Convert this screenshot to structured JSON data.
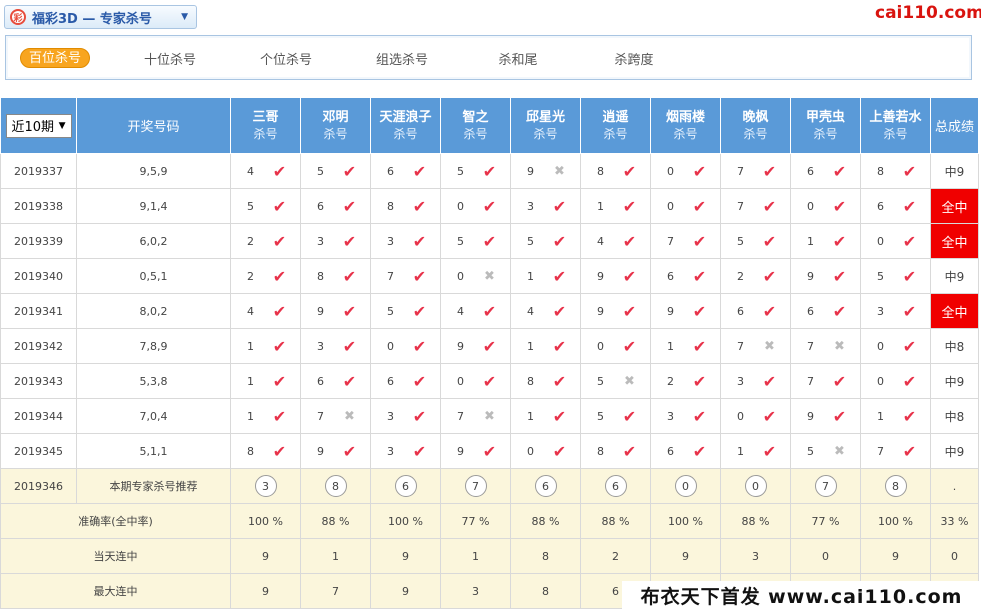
{
  "header": {
    "logo_char": "彩",
    "lottery_title": "福彩3D — 专家杀号",
    "site_logo": "cai110.com"
  },
  "tabs": [
    "百位杀号",
    "十位杀号",
    "个位杀号",
    "组选杀号",
    "杀和尾",
    "杀跨度"
  ],
  "active_tab": 0,
  "table": {
    "period_select": "近10期",
    "draw_col": "开奖号码",
    "total_col": "总成绩",
    "expert_sub": "杀号",
    "experts": [
      "三哥",
      "邓明",
      "天涯浪子",
      "智之",
      "邱星光",
      "逍遥",
      "烟雨楼",
      "晚枫",
      "甲壳虫",
      "上善若水"
    ],
    "rows": [
      {
        "issue": "2019337",
        "draw": "9,5,9",
        "kills": [
          4,
          5,
          6,
          5,
          9,
          8,
          0,
          7,
          6,
          8
        ],
        "hits": [
          1,
          1,
          1,
          1,
          0,
          1,
          1,
          1,
          1,
          1
        ],
        "total": "中9",
        "all": false
      },
      {
        "issue": "2019338",
        "draw": "9,1,4",
        "kills": [
          5,
          6,
          8,
          0,
          3,
          1,
          0,
          7,
          0,
          6
        ],
        "hits": [
          1,
          1,
          1,
          1,
          1,
          1,
          1,
          1,
          1,
          1
        ],
        "total": "全中",
        "all": true
      },
      {
        "issue": "2019339",
        "draw": "6,0,2",
        "kills": [
          2,
          3,
          3,
          5,
          5,
          4,
          7,
          5,
          1,
          0
        ],
        "hits": [
          1,
          1,
          1,
          1,
          1,
          1,
          1,
          1,
          1,
          1
        ],
        "total": "全中",
        "all": true
      },
      {
        "issue": "2019340",
        "draw": "0,5,1",
        "kills": [
          2,
          8,
          7,
          0,
          1,
          9,
          6,
          2,
          9,
          5
        ],
        "hits": [
          1,
          1,
          1,
          0,
          1,
          1,
          1,
          1,
          1,
          1
        ],
        "total": "中9",
        "all": false
      },
      {
        "issue": "2019341",
        "draw": "8,0,2",
        "kills": [
          4,
          9,
          5,
          4,
          4,
          9,
          9,
          6,
          6,
          3
        ],
        "hits": [
          1,
          1,
          1,
          1,
          1,
          1,
          1,
          1,
          1,
          1
        ],
        "total": "全中",
        "all": true
      },
      {
        "issue": "2019342",
        "draw": "7,8,9",
        "kills": [
          1,
          3,
          0,
          9,
          1,
          0,
          1,
          7,
          7,
          0
        ],
        "hits": [
          1,
          1,
          1,
          1,
          1,
          1,
          1,
          0,
          0,
          1
        ],
        "total": "中8",
        "all": false
      },
      {
        "issue": "2019343",
        "draw": "5,3,8",
        "kills": [
          1,
          6,
          6,
          0,
          8,
          5,
          2,
          3,
          7,
          0
        ],
        "hits": [
          1,
          1,
          1,
          1,
          1,
          0,
          1,
          1,
          1,
          1
        ],
        "total": "中9",
        "all": false
      },
      {
        "issue": "2019344",
        "draw": "7,0,4",
        "kills": [
          1,
          7,
          3,
          7,
          1,
          5,
          3,
          0,
          9,
          1
        ],
        "hits": [
          1,
          0,
          1,
          0,
          1,
          1,
          1,
          1,
          1,
          1
        ],
        "total": "中8",
        "all": false
      },
      {
        "issue": "2019345",
        "draw": "5,1,1",
        "kills": [
          8,
          9,
          3,
          9,
          0,
          8,
          6,
          1,
          5,
          7
        ],
        "hits": [
          1,
          1,
          1,
          1,
          1,
          1,
          1,
          1,
          0,
          1
        ],
        "total": "中9",
        "all": false
      }
    ],
    "recommend": {
      "issue": "2019346",
      "label": "本期专家杀号推荐",
      "values": [
        3,
        8,
        6,
        7,
        6,
        6,
        0,
        0,
        7,
        8
      ],
      "total": "."
    },
    "stats": [
      {
        "label": "准确率(全中率)",
        "values": [
          "100 %",
          "88 %",
          "100 %",
          "77 %",
          "88 %",
          "88 %",
          "100 %",
          "88 %",
          "77 %",
          "100 %"
        ],
        "total": "33 %"
      },
      {
        "label": "当天连中",
        "values": [
          "9",
          "1",
          "9",
          "1",
          "8",
          "2",
          "9",
          "3",
          "0",
          "9"
        ],
        "total": "0"
      },
      {
        "label": "最大连中",
        "values": [
          "9",
          "7",
          "9",
          "3",
          "8",
          "6",
          "",
          "",
          "",
          "",
          ""
        ],
        "total": ""
      }
    ]
  },
  "footer_banner": "布衣天下首发 www.cai110.com",
  "icons": {
    "hit": "red-check-icon",
    "miss": "gray-cross-icon"
  },
  "colors": {
    "header_blue": "#5a9ad8",
    "accent_orange": "#f8a51f",
    "all_hit_red": "#f00000",
    "check_red": "#e8324a"
  }
}
